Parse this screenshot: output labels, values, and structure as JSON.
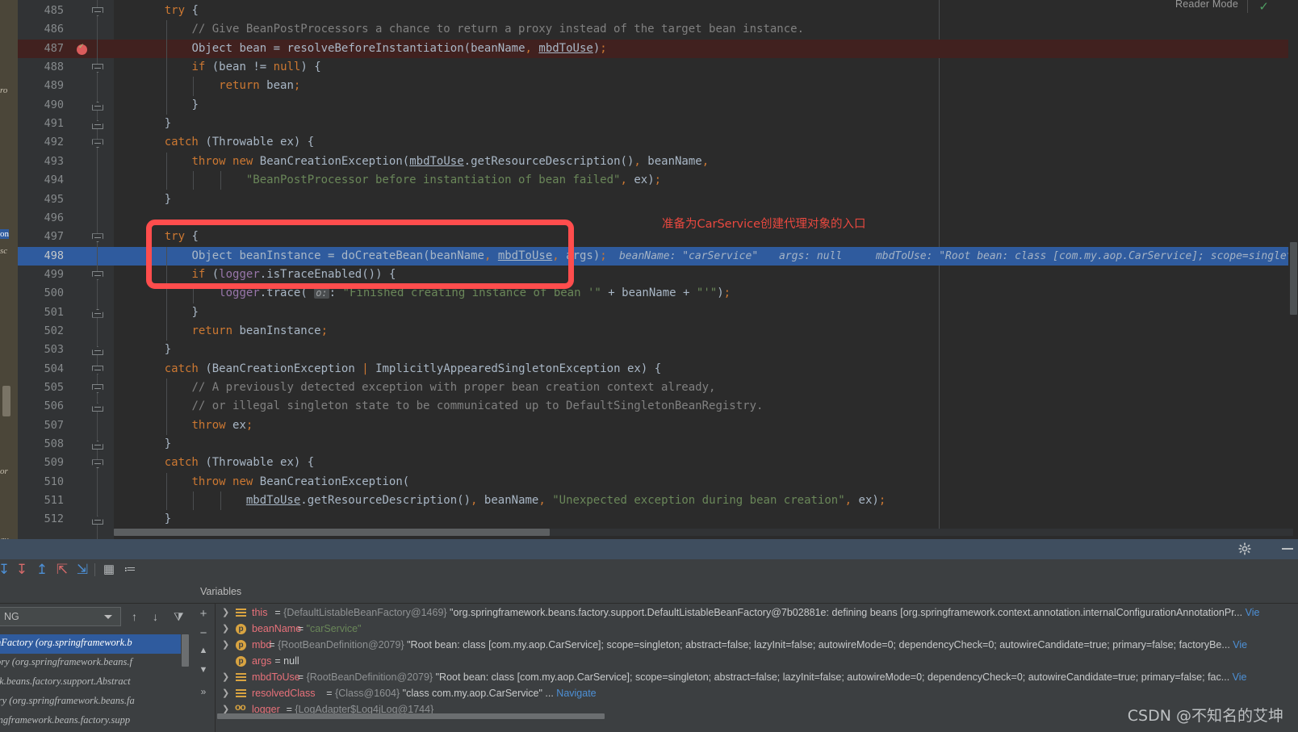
{
  "editor": {
    "reader_mode_label": "Reader Mode",
    "first_line_number": 485,
    "current_line": 498,
    "breakpoint_line": 487,
    "lines": [
      {
        "n": 485,
        "fold": "open",
        "indent": 1,
        "code": "try {"
      },
      {
        "n": 486,
        "fold": null,
        "indent": 2,
        "code": "// Give BeanPostProcessors a chance to return a proxy instead of the target bean instance."
      },
      {
        "n": 487,
        "fold": null,
        "indent": 2,
        "code": "Object bean = resolveBeforeInstantiation(beanName, mbdToUse);"
      },
      {
        "n": 488,
        "fold": "open",
        "indent": 2,
        "code": "if (bean != null) {"
      },
      {
        "n": 489,
        "fold": null,
        "indent": 3,
        "code": "return bean;"
      },
      {
        "n": 490,
        "fold": "close",
        "indent": 2,
        "code": "}"
      },
      {
        "n": 491,
        "fold": "close",
        "indent": 1,
        "code": "}"
      },
      {
        "n": 492,
        "fold": "open",
        "indent": 1,
        "code": "catch (Throwable ex) {"
      },
      {
        "n": 493,
        "fold": null,
        "indent": 2,
        "code": "throw new BeanCreationException(mbdToUse.getResourceDescription(), beanName,"
      },
      {
        "n": 494,
        "fold": null,
        "indent": 4,
        "code": "\"BeanPostProcessor before instantiation of bean failed\", ex);"
      },
      {
        "n": 495,
        "fold": null,
        "indent": 1,
        "code": "}"
      },
      {
        "n": 496,
        "fold": null,
        "indent": 0,
        "code": ""
      },
      {
        "n": 497,
        "fold": "open",
        "indent": 1,
        "code": "try {"
      },
      {
        "n": 498,
        "fold": null,
        "indent": 2,
        "code": "Object beanInstance = doCreateBean(beanName, mbdToUse, args);"
      },
      {
        "n": 499,
        "fold": "open",
        "indent": 2,
        "code": "if (logger.isTraceEnabled()) {"
      },
      {
        "n": 500,
        "fold": null,
        "indent": 3,
        "code": "logger.trace( o: \"Finished creating instance of bean '\" + beanName + \"'\");"
      },
      {
        "n": 501,
        "fold": "close",
        "indent": 2,
        "code": "}"
      },
      {
        "n": 502,
        "fold": null,
        "indent": 2,
        "code": "return beanInstance;"
      },
      {
        "n": 503,
        "fold": "close",
        "indent": 1,
        "code": "}"
      },
      {
        "n": 504,
        "fold": "open",
        "indent": 1,
        "code": "catch (BeanCreationException | ImplicitlyAppearedSingletonException ex) {"
      },
      {
        "n": 505,
        "fold": "open",
        "indent": 2,
        "code": "// A previously detected exception with proper bean creation context already,"
      },
      {
        "n": 506,
        "fold": "close",
        "indent": 2,
        "code": "// or illegal singleton state to be communicated up to DefaultSingletonBeanRegistry."
      },
      {
        "n": 507,
        "fold": null,
        "indent": 2,
        "code": "throw ex;"
      },
      {
        "n": 508,
        "fold": "close",
        "indent": 1,
        "code": "}"
      },
      {
        "n": 509,
        "fold": "open",
        "indent": 1,
        "code": "catch (Throwable ex) {"
      },
      {
        "n": 510,
        "fold": null,
        "indent": 2,
        "code": "throw new BeanCreationException("
      },
      {
        "n": 511,
        "fold": null,
        "indent": 4,
        "code": "mbdToUse.getResourceDescription(), beanName, \"Unexpected exception during bean creation\", ex);"
      },
      {
        "n": 512,
        "fold": "close",
        "indent": 1,
        "code": "}"
      }
    ],
    "inline_debug_hints": {
      "beanName": "beanName: \"carService\"",
      "args": "args: null",
      "mbdToUse": "mbdToUse: \"Root bean: class [com.my.aop.CarService]; scope=singleton; ab"
    }
  },
  "annotation": {
    "text": "准备为CarService创建代理对象的入口",
    "box_color": "#ff4d4d",
    "text_color": "#e8483f"
  },
  "left_strip": {
    "lines": [
      "ro",
      "on",
      "sc",
      "or",
      "av"
    ]
  },
  "debug": {
    "toolbar_icons": [
      "step-over-icon",
      "step-into-icon",
      "force-step-into-icon",
      "step-out-icon",
      "drop-frame-icon",
      "run-to-cursor-icon",
      "evaluate-expression-icon",
      "show-frames-icon"
    ],
    "gear_icon": "gear-icon",
    "minimize_icon": "minimize-icon",
    "frames": {
      "thread_value": "NG",
      "items": [
        "ableBeanFactory (org.springframework.b",
        "eanFactory (org.springframework.beans.f",
        "ramework.beans.factory.support.Abstract",
        "anRegistry (org.springframework.beans.fa",
        " (org.springframework.beans.factory.supp"
      ],
      "selected_index": 0,
      "buttons": [
        "up-frame-icon",
        "down-frame-icon",
        "filter-icon"
      ]
    },
    "variables": {
      "title": "Variables",
      "side_buttons": [
        "add-watch-icon",
        "remove-watch-icon",
        "move-up-icon",
        "move-down-icon",
        "expand-more-icon"
      ],
      "rows": [
        {
          "expandable": true,
          "icon": "field-icon",
          "name": "this",
          "eq": " = ",
          "id": "{DefaultListableBeanFactory@1469}",
          "value": " \"org.springframework.beans.factory.support.DefaultListableBeanFactory@7b02881e: defining beans [org.springframework.context.annotation.internalConfigurationAnnotationPr...",
          "link": " Vie"
        },
        {
          "expandable": true,
          "icon": "param-icon",
          "name": "beanName",
          "eq": " = ",
          "id": "",
          "value": "",
          "str": "\"carService\"",
          "link": ""
        },
        {
          "expandable": true,
          "icon": "param-icon",
          "name": "mbd",
          "eq": " = ",
          "id": "{RootBeanDefinition@2079}",
          "value": " \"Root bean: class [com.my.aop.CarService]; scope=singleton; abstract=false; lazyInit=false; autowireMode=0; dependencyCheck=0; autowireCandidate=true; primary=false; factoryBe...",
          "link": " Vie"
        },
        {
          "expandable": false,
          "icon": "param-icon",
          "name": "args",
          "eq": " = ",
          "id": "",
          "value": "null",
          "link": ""
        },
        {
          "expandable": true,
          "icon": "field-icon",
          "name": "mbdToUse",
          "eq": " = ",
          "id": "{RootBeanDefinition@2079}",
          "value": " \"Root bean: class [com.my.aop.CarService]; scope=singleton; abstract=false; lazyInit=false; autowireMode=0; dependencyCheck=0; autowireCandidate=true; primary=false; fac...",
          "link": " Vie"
        },
        {
          "expandable": true,
          "icon": "field-icon",
          "name": "resolvedClass",
          "eq": " = ",
          "id": "{Class@1604}",
          "value": " \"class com.my.aop.CarService\" ...",
          "link": " Navigate"
        },
        {
          "expandable": true,
          "icon": "static-icon",
          "name": "logger",
          "eq": " = ",
          "id": "{LogAdapter$Log4jLog@1744}",
          "value": "",
          "link": ""
        }
      ]
    }
  },
  "watermark": "CSDN @不知名的艾坤"
}
